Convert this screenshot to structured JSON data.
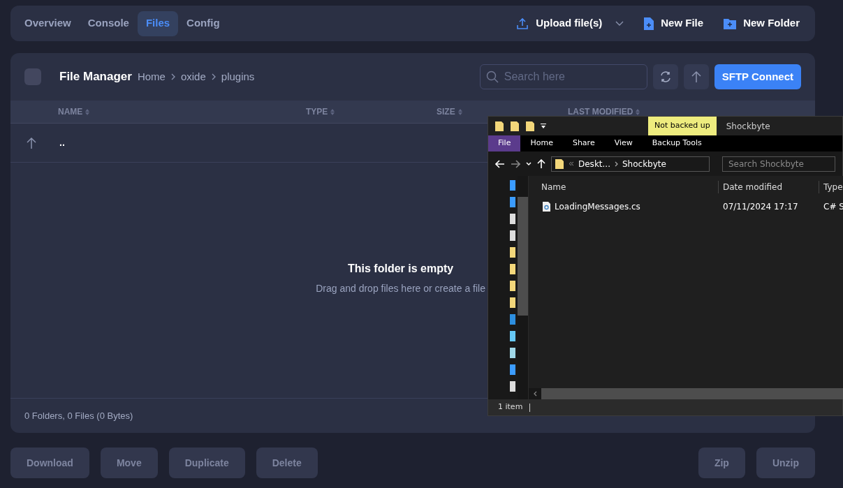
{
  "tabs": [
    {
      "label": "Overview",
      "selected": false
    },
    {
      "label": "Console",
      "selected": false
    },
    {
      "label": "Files",
      "selected": true
    },
    {
      "label": "Config",
      "selected": false
    }
  ],
  "actions": [
    {
      "kind": "upload",
      "label": "Upload file(s)"
    },
    {
      "kind": "new-file",
      "label": "New File"
    },
    {
      "kind": "new-folder",
      "label": "New Folder"
    }
  ],
  "file_manager": {
    "title": "File Manager",
    "select_all": {
      "checked": false
    },
    "breadcrumb": [
      "Home",
      "oxide",
      "plugins"
    ],
    "search": {
      "placeholder": "Search here"
    },
    "sftp_button": "SFTP Connect",
    "columns": [
      "NAME",
      "TYPE",
      "SIZE",
      "LAST MODIFIED"
    ],
    "parent_row": "..",
    "empty_title": "This folder is empty",
    "empty_hint": "Drag and drop files here or create a file",
    "summary": "0 Folders, 0 Files (0 Bytes)"
  },
  "bulk_buttons": {
    "left": [
      "Download",
      "Move",
      "Duplicate",
      "Delete"
    ],
    "right": [
      "Zip",
      "Unzip"
    ]
  },
  "explorer": {
    "title_badge": "Not backed up",
    "title": "Shockbyte",
    "ribbon_tabs": [
      {
        "label": "File",
        "selected": true
      },
      {
        "label": "Home",
        "selected": false
      },
      {
        "label": "Share",
        "selected": false
      },
      {
        "label": "View",
        "selected": false
      },
      {
        "label": "Backup Tools",
        "selected": false
      }
    ],
    "path": [
      "Deskt...",
      "Shockbyte"
    ],
    "search": {
      "placeholder": "Search Shockbyte"
    },
    "columns": [
      "Name",
      "Date modified",
      "Type"
    ],
    "rows": [
      {
        "name": "LoadingMessages.cs",
        "date": "07/11/2024 17:17",
        "type": "C# S"
      }
    ],
    "status": "1 item"
  }
}
